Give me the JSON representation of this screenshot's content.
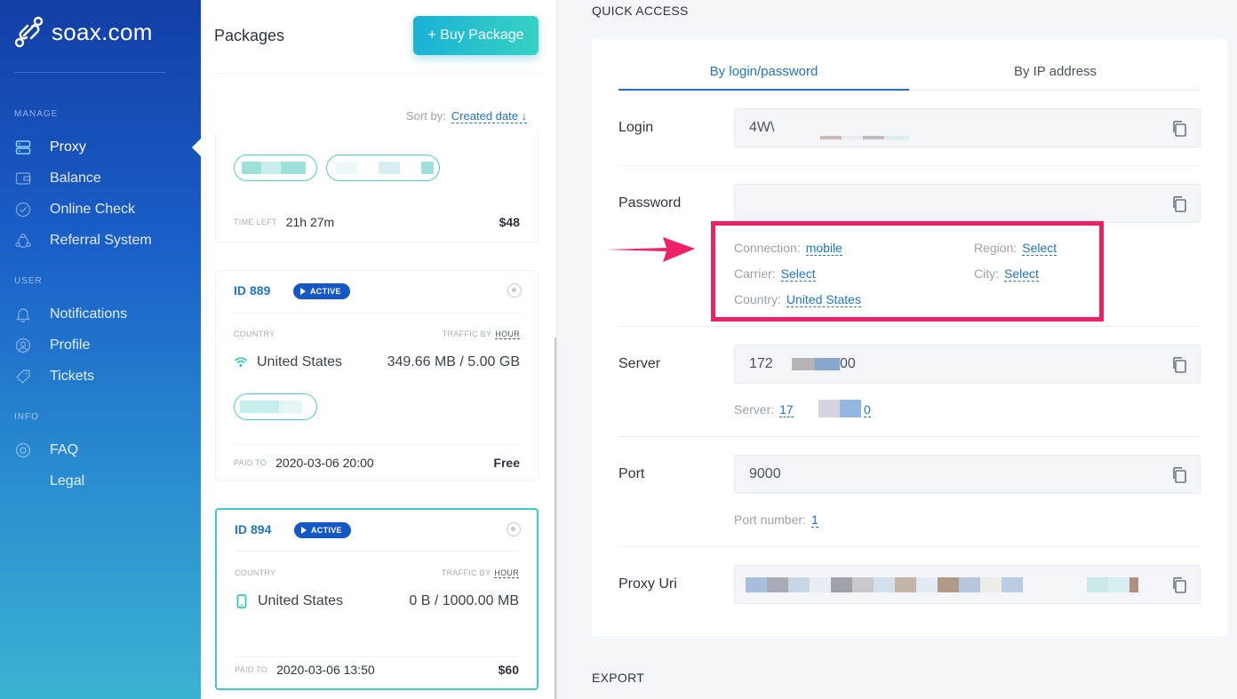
{
  "app": {
    "logo_text": "soax.com"
  },
  "sidebar": {
    "sections": [
      {
        "label": "MANAGE"
      },
      {
        "label": "USER"
      },
      {
        "label": "INFO"
      }
    ],
    "items": [
      {
        "label": "Proxy",
        "icon": "server-icon"
      },
      {
        "label": "Balance",
        "icon": "wallet-icon"
      },
      {
        "label": "Online Check",
        "icon": "check-circle-icon"
      },
      {
        "label": "Referral System",
        "icon": "referral-icon"
      },
      {
        "label": "Notifications",
        "icon": "bell-icon"
      },
      {
        "label": "Profile",
        "icon": "user-circle-icon"
      },
      {
        "label": "Tickets",
        "icon": "tag-icon"
      },
      {
        "label": "FAQ",
        "icon": "lifebuoy-icon"
      },
      {
        "label": "Legal",
        "icon": ""
      }
    ],
    "active_item": "Proxy"
  },
  "packages": {
    "title": "Packages",
    "buy_button": "+ Buy Package",
    "sort_label": "Sort by:",
    "sort_value": "Created date ↓",
    "cards": [
      {
        "time_left_label": "TIME LEFT",
        "time_left": "21h 27m",
        "price": "$48"
      },
      {
        "id_label": "ID",
        "id": "889",
        "status": "ACTIVE",
        "country_label": "COUNTRY",
        "traffic_label": "TRAFFIC BY",
        "traffic_unit": "HOUR",
        "country": "United States",
        "traffic": "349.66 MB / 5.00 GB",
        "paid_label": "PAID TO",
        "paid_to": "2020-03-06 20:00",
        "price": "Free",
        "connection_icon": "wifi-icon"
      },
      {
        "id_label": "ID",
        "id": "894",
        "status": "ACTIVE",
        "country_label": "COUNTRY",
        "traffic_label": "TRAFFIC BY",
        "traffic_unit": "HOUR",
        "country": "United States",
        "traffic": "0 B / 1000.00 MB",
        "paid_label": "PAID TO",
        "paid_to": "2020-03-06 13:50",
        "price": "$60",
        "connection_icon": "mobile-icon"
      }
    ]
  },
  "quick_access": {
    "title": "QUICK ACCESS",
    "tabs": [
      "By login/password",
      "By IP address"
    ],
    "active_tab": "By login/password",
    "login": {
      "label": "Login",
      "value": "4W\\"
    },
    "password": {
      "label": "Password",
      "value": ""
    },
    "filters": {
      "connection_label": "Connection:",
      "connection": "mobile",
      "region_label": "Region:",
      "region": "Select",
      "carrier_label": "Carrier:",
      "carrier": "Select",
      "city_label": "City:",
      "city": "Select",
      "country_label": "Country:",
      "country": "United States"
    },
    "server": {
      "label": "Server",
      "value_start": "172",
      "value_end": "00",
      "sub_label": "Server:",
      "sub_start": "17",
      "sub_end": "0"
    },
    "port": {
      "label": "Port",
      "value": "9000",
      "sub_label": "Port number:",
      "sub_value": "1"
    },
    "proxy_uri": {
      "label": "Proxy Uri"
    }
  },
  "export": {
    "title": "EXPORT"
  },
  "colors": {
    "accent": "#1f73c9",
    "highlight": "#ef1f68",
    "teal": "#46c9c4"
  }
}
